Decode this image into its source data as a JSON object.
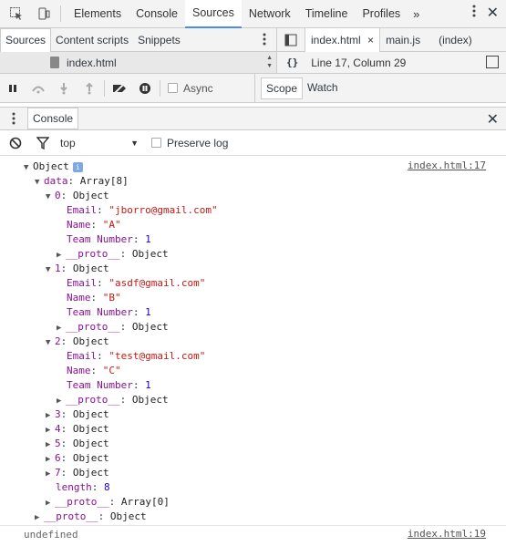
{
  "topbar": {
    "tabs": [
      "Elements",
      "Console",
      "Sources",
      "Network",
      "Timeline",
      "Profiles"
    ],
    "active_tab": "Sources",
    "more_label": "»"
  },
  "navigator": {
    "tabs": [
      "Sources",
      "Content scripts",
      "Snippets"
    ],
    "file": "index.html"
  },
  "editor": {
    "tabs": [
      "index.html",
      "main.js",
      "(index)"
    ],
    "close_glyph": "×",
    "braces": "{}",
    "position": "Line 17, Column 29"
  },
  "debugger": {
    "async_label": "Async",
    "scope_tabs": [
      "Scope",
      "Watch"
    ]
  },
  "drawer": {
    "tab": "Console"
  },
  "console_toolbar": {
    "context": "top",
    "preserve_log": "Preserve log"
  },
  "console": {
    "log1_link": "index.html:17",
    "log2_link": "index.html:19",
    "root": "Object",
    "data_key": "data",
    "data_val": "Array[8]",
    "items": [
      {
        "idx": "0",
        "email": "\"jborro@gmail.com\"",
        "name": "\"A\"",
        "team": "1"
      },
      {
        "idx": "1",
        "email": "\"asdf@gmail.com\"",
        "name": "\"B\"",
        "team": "1"
      },
      {
        "idx": "2",
        "email": "\"test@gmail.com\"",
        "name": "\"C\"",
        "team": "1"
      }
    ],
    "collapsed": [
      "3",
      "4",
      "5",
      "6",
      "7"
    ],
    "object_word": "Object",
    "email_key": "Email",
    "name_key": "Name",
    "team_key": "Team Number",
    "proto_key": "__proto__",
    "length_key": "length",
    "length_val": "8",
    "array_proto": "Array[0]",
    "undefined_text": "undefined"
  }
}
